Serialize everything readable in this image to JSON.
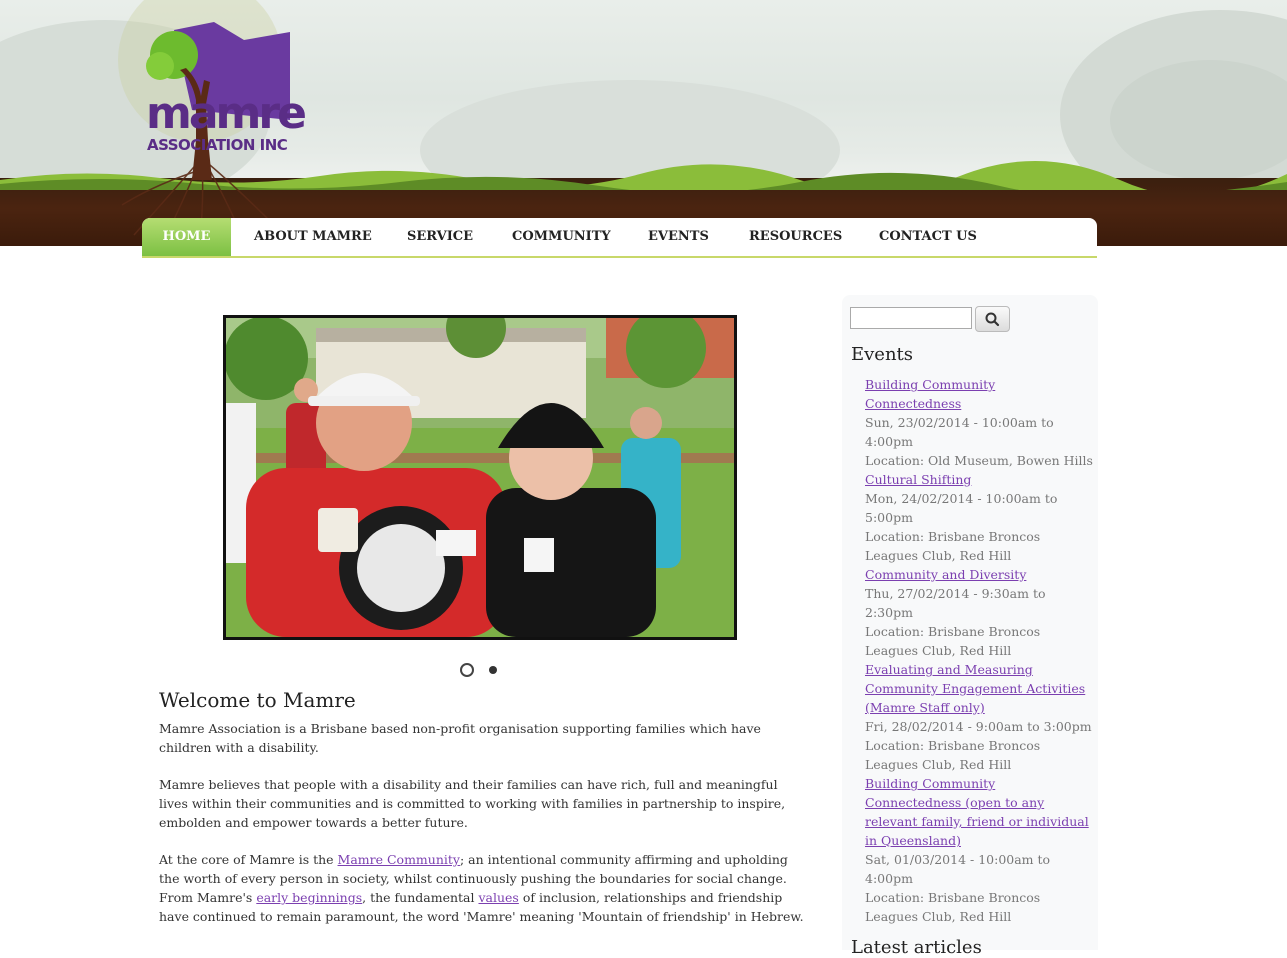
{
  "logo": {
    "word": "mamre",
    "subtitle": "ASSOCIATION INC"
  },
  "nav": {
    "items": [
      {
        "label": "HOME",
        "active": true
      },
      {
        "label": "ABOUT MAMRE"
      },
      {
        "label": "SERVICE"
      },
      {
        "label": "COMMUNITY"
      },
      {
        "label": "EVENTS"
      },
      {
        "label": "RESOURCES"
      },
      {
        "label": "CONTACT US"
      }
    ]
  },
  "slideshow": {
    "slide_count": 2,
    "active_index": 0
  },
  "main": {
    "title": "Welcome to Mamre",
    "para1": "Mamre Association is a Brisbane based non-profit organisation supporting families which have children with a disability.",
    "para2": "Mamre believes that people with a disability and their families can have rich, full and meaningful lives within their communities and is committed to working with families in partnership to inspire, embolden and empower towards a better future.",
    "para3": {
      "t1": "At the core of Mamre is the ",
      "link1": "Mamre Community",
      "t2": "; an intentional community affirming and upholding the worth of every person in society, whilst continuously pushing the boundaries for social change. From Mamre's ",
      "link2": "early beginnings",
      "t3": ", the fundamental ",
      "link3": "values",
      "t4": " of inclusion, relationships and friendship have continued to remain paramount, the word 'Mamre' meaning 'Mountain of friendship' in Hebrew."
    }
  },
  "sidebar": {
    "search": {
      "value": "",
      "button_icon": "search-icon"
    },
    "events_title": "Events",
    "events": [
      {
        "title": "Building Community Connectedness",
        "date": "Sun, 23/02/2014 - 10:00am to 4:00pm",
        "location": "Location: Old Museum, Bowen Hills"
      },
      {
        "title": "Cultural Shifting",
        "date": "Mon, 24/02/2014 - 10:00am to 5:00pm",
        "location": "Location: Brisbane Broncos Leagues Club, Red Hill"
      },
      {
        "title": "Community and Diversity",
        "date": "Thu, 27/02/2014 - 9:30am to 2:30pm",
        "location": "Location: Brisbane Broncos Leagues Club, Red Hill"
      },
      {
        "title": "Evaluating and Measuring Community Engagement Activities (Mamre Staff only)",
        "date": "Fri, 28/02/2014 - 9:00am to 3:00pm",
        "location": "Location: Brisbane Broncos Leagues Club, Red Hill"
      },
      {
        "title": "Building Community Connectedness (open to any relevant family, friend or individual in Queensland)",
        "date": "Sat, 01/03/2014 - 10:00am to 4:00pm",
        "location": "Location: Brisbane Broncos Leagues Club, Red Hill"
      }
    ],
    "latest_title": "Latest articles"
  },
  "colors": {
    "accent_green": "#7cc043",
    "link_purple": "#7b3fb0",
    "logo_purple": "#5a2d86",
    "soil_brown": "#4b2410"
  }
}
